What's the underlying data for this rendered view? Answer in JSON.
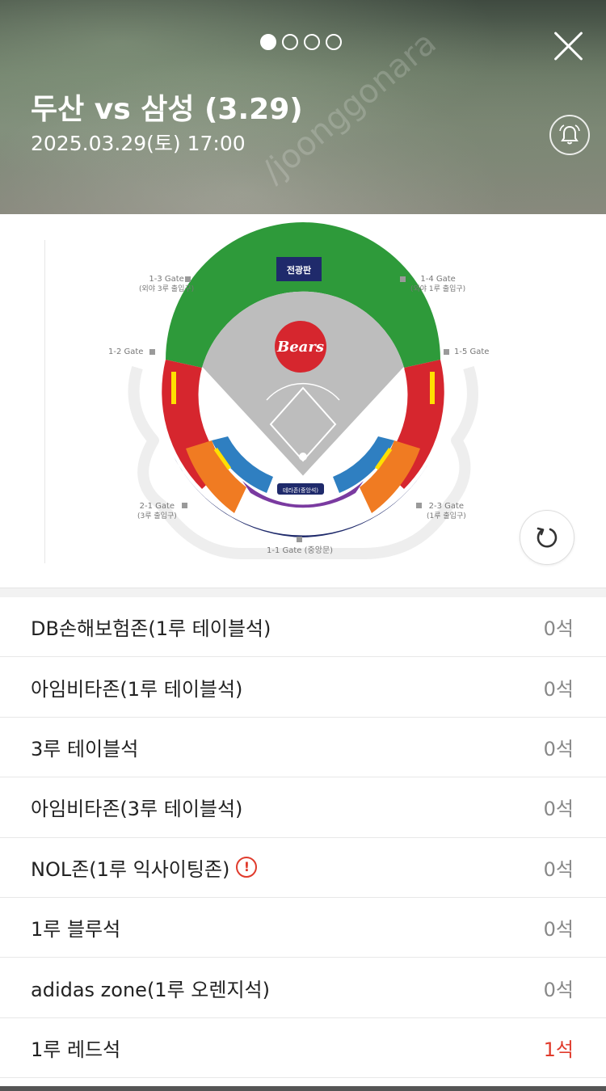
{
  "header": {
    "title": "두산 vs 삼성 (3.29)",
    "datetime": "2025.03.29(토) 17:00",
    "watermark": "/joonggonara",
    "page_indicator": {
      "total": 4,
      "current": 1
    },
    "close_icon": "close-icon",
    "bell_icon": "bell-icon"
  },
  "stadium": {
    "scoreboard_label": "전광판",
    "logo_text": "Bears",
    "terrace_label": "테라존(중앙석)",
    "gates": {
      "g13": "1-3 Gate",
      "g13_sub": "(외야 3루 출입구)",
      "g14": "1-4 Gate",
      "g14_sub": "(외야 1루 출입구)",
      "g12": "1-2 Gate",
      "g15": "1-5 Gate",
      "g21": "2-1 Gate",
      "g21_sub": "(3루 출입구)",
      "g23": "2-3 Gate",
      "g23_sub": "(1루 출입구)",
      "g11": "1-1 Gate (중앙문)"
    },
    "zone_colors": {
      "outfield": "#2e9a3a",
      "navy": "#1f2a6b",
      "red": "#d6262e",
      "orange": "#f07b22",
      "blue": "#2f7fc1",
      "purple": "#7a3aa0",
      "yellow": "#ffe000",
      "field": "#bdbdbd"
    },
    "refresh_icon": "refresh-icon"
  },
  "sections": [
    {
      "name": "DB손해보험존(1루 테이블석)",
      "count": "0석",
      "available": false
    },
    {
      "name": "아임비타존(1루 테이블석)",
      "count": "0석",
      "available": false
    },
    {
      "name": "3루 테이블석",
      "count": "0석",
      "available": false
    },
    {
      "name": "아임비타존(3루 테이블석)",
      "count": "0석",
      "available": false
    },
    {
      "name": "NOL존(1루 익사이팅존)",
      "count": "0석",
      "available": false,
      "info": "!"
    },
    {
      "name": "1루 블루석",
      "count": "0석",
      "available": false
    },
    {
      "name": "adidas zone(1루 오렌지석)",
      "count": "0석",
      "available": false
    },
    {
      "name": "1루 레드석",
      "count": "1석",
      "available": true
    }
  ]
}
